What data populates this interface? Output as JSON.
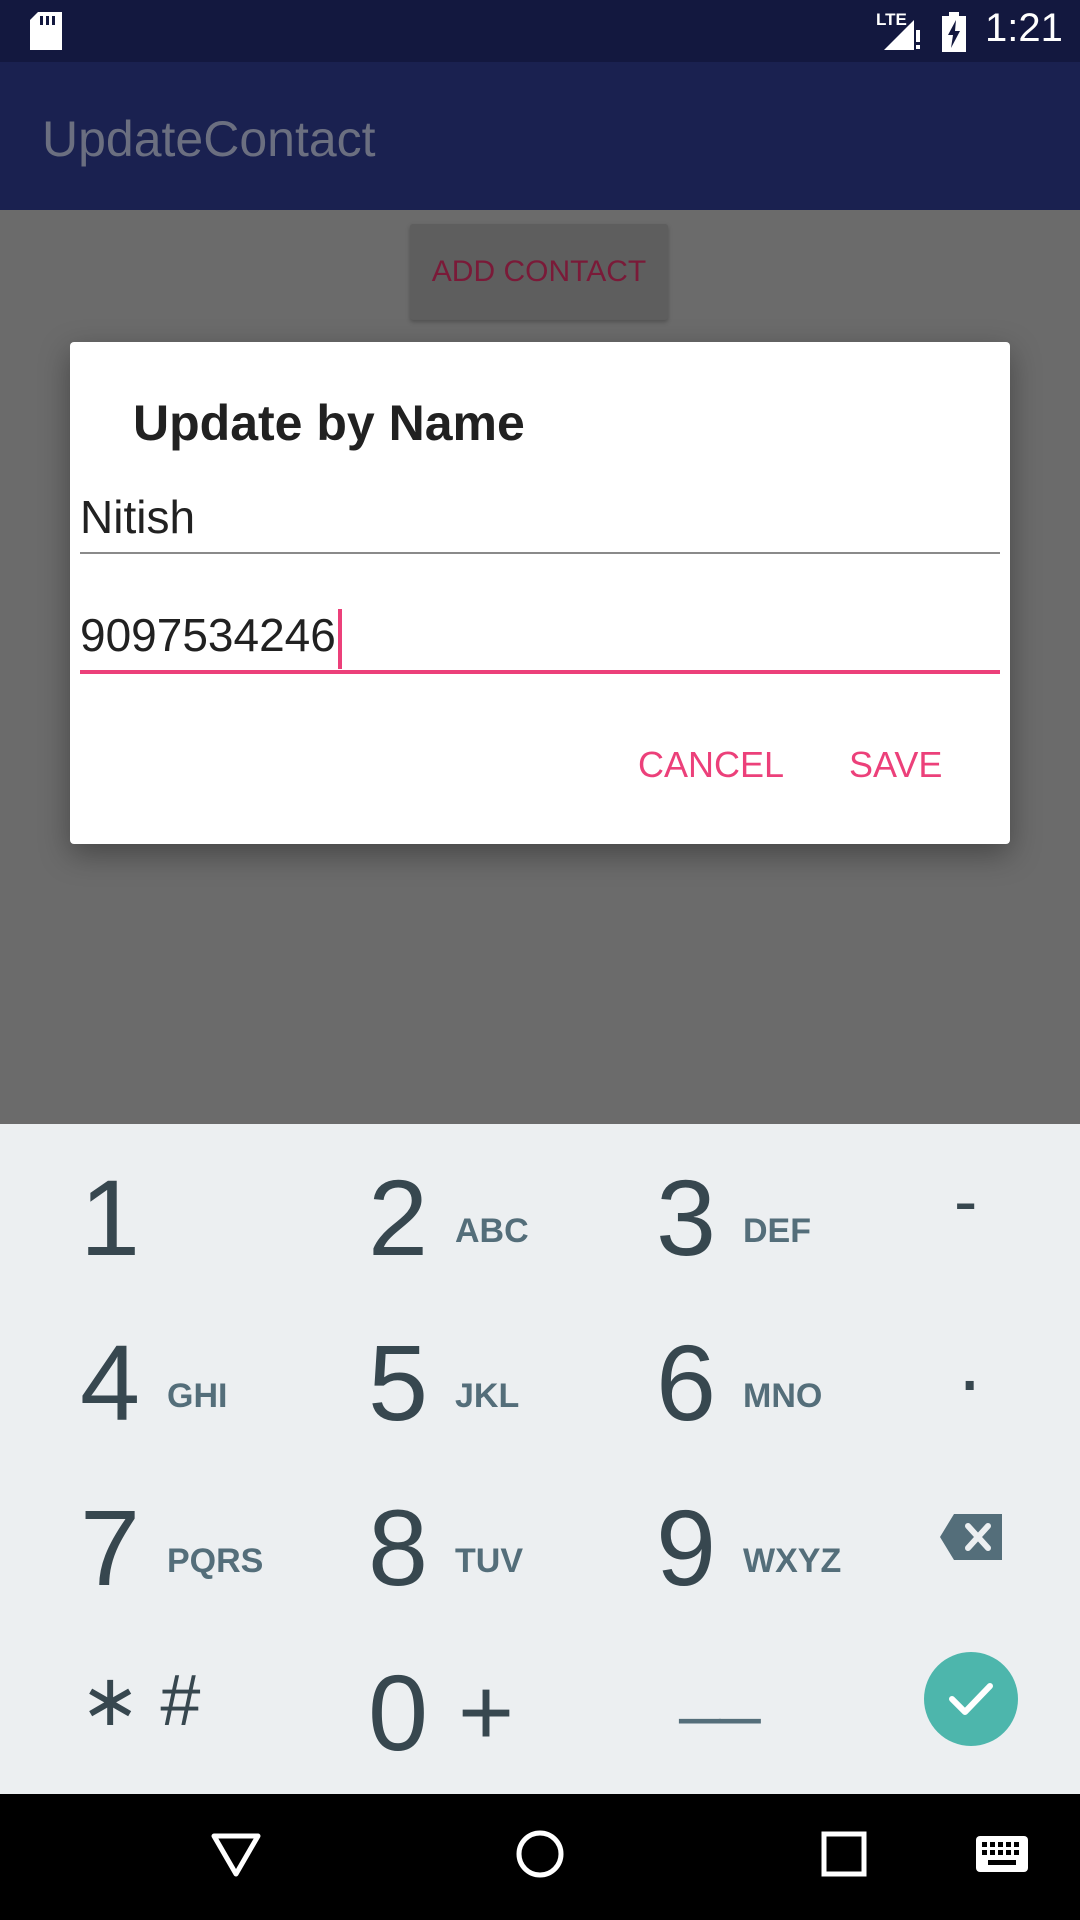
{
  "status_bar": {
    "network_label": "LTE",
    "time": "1:21"
  },
  "app_bar": {
    "title": "UpdateContact"
  },
  "content": {
    "add_contact_label": "ADD CONTACT"
  },
  "dialog": {
    "title": "Update by Name",
    "name_value": "Nitish",
    "phone_value": "9097534246",
    "cancel_label": "CANCEL",
    "save_label": "SAVE"
  },
  "keyboard": {
    "keys": [
      {
        "digit": "1",
        "letters": ""
      },
      {
        "digit": "2",
        "letters": "ABC"
      },
      {
        "digit": "3",
        "letters": "DEF"
      },
      {
        "digit": "4",
        "letters": "GHI"
      },
      {
        "digit": "5",
        "letters": "JKL"
      },
      {
        "digit": "6",
        "letters": "MNO"
      },
      {
        "digit": "7",
        "letters": "PQRS"
      },
      {
        "digit": "8",
        "letters": "TUV"
      },
      {
        "digit": "9",
        "letters": "WXYZ"
      },
      {
        "digit": "0",
        "letters": "+"
      }
    ],
    "dash": "-",
    "dot": ".",
    "star_hash": "∗ #",
    "space": "__",
    "icons": [
      "backspace-icon",
      "checkmark-icon"
    ]
  },
  "nav_bar": {
    "icons": [
      "back-icon",
      "home-icon",
      "recents-icon",
      "keyboard-icon"
    ]
  },
  "colors": {
    "accent": "#ec407a",
    "status_bar": "#13183f",
    "app_bar": "#1a2150",
    "done": "#4db6ac",
    "keyboard_bg": "#eceff1"
  }
}
